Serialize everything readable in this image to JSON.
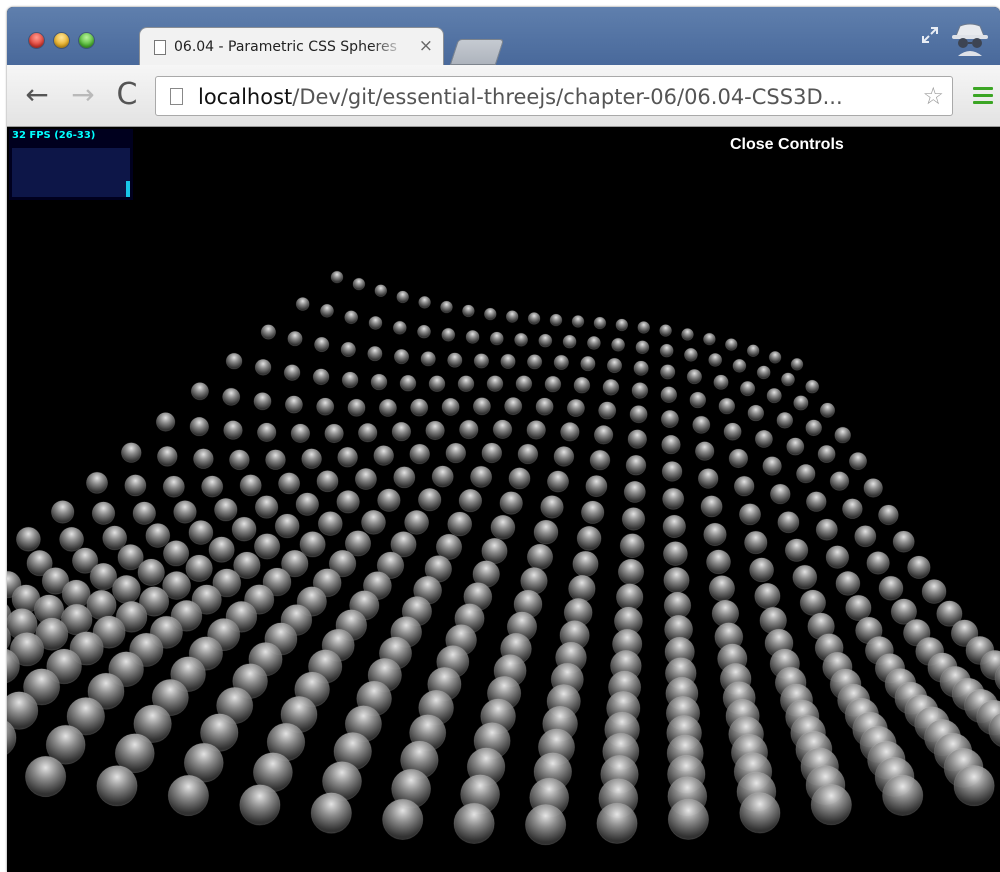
{
  "browser": {
    "tab": {
      "title": "06.04 - Parametric CSS Spheres",
      "close_glyph": "×"
    },
    "toolbar": {
      "back_glyph": "←",
      "forward_glyph": "→",
      "reload_glyph": "C",
      "url_host": "localhost",
      "url_path": "/Dev/git/essential-threejs/chapter-06/06.04-CSS3D...",
      "star_glyph": "☆"
    },
    "icons": [
      "fullscreen-icon",
      "incognito-icon",
      "menu-icon",
      "page-icon",
      "star-icon"
    ]
  },
  "page": {
    "stats": {
      "fps_text": "32 FPS (26-33)",
      "fps_level": 0.33,
      "color": "#00ffff"
    },
    "controls": {
      "close_label": "Close Controls"
    },
    "scene_colors": {
      "background": "#000000",
      "sphere": "#8a8a8a"
    }
  }
}
